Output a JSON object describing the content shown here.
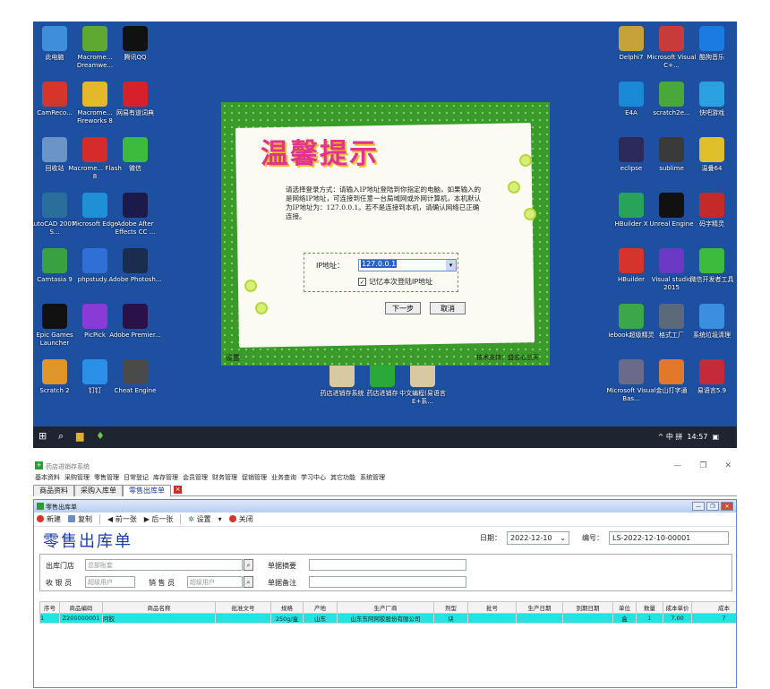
{
  "desktop": {
    "icons_left": [
      {
        "label": "此电脑",
        "icon": "computer-icon",
        "color": "#3d8fd9"
      },
      {
        "label": "Macrome... Dreamwe...",
        "icon": "dreamweaver-icon",
        "color": "#5fa832"
      },
      {
        "label": "腾讯QQ",
        "icon": "qq-icon",
        "color": "#111111"
      },
      {
        "label": "CamReco...",
        "icon": "camtasia-recorder-icon",
        "color": "#d6362a"
      },
      {
        "label": "Macrome... Fireworks 8",
        "icon": "fireworks-icon",
        "color": "#e5b82c"
      },
      {
        "label": "网易有道词典",
        "icon": "youdao-icon",
        "color": "#d6202a"
      },
      {
        "label": "回收站",
        "icon": "recycle-bin-icon",
        "color": "#6a94c4"
      },
      {
        "label": "Macrome... Flash 8",
        "icon": "flash-icon",
        "color": "#d62b2b"
      },
      {
        "label": "微信",
        "icon": "wechat-icon",
        "color": "#3dbb3d"
      },
      {
        "label": "AutoCAD 2007 - S...",
        "icon": "autocad-icon",
        "color": "#2a6f9b"
      },
      {
        "label": "Microsoft Edge",
        "icon": "edge-icon",
        "color": "#1f8fd6"
      },
      {
        "label": "Adobe After Effects CC ...",
        "icon": "after-effects-icon",
        "color": "#1c1a4a"
      },
      {
        "label": "Camtasia 9",
        "icon": "camtasia-icon",
        "color": "#3aa142"
      },
      {
        "label": "phpstudy...",
        "icon": "phpstudy-icon",
        "color": "#2f6fd6"
      },
      {
        "label": "Adobe Photosh...",
        "icon": "photoshop-icon",
        "color": "#1a2d4f"
      },
      {
        "label": "Epic Games Launcher",
        "icon": "epic-games-icon",
        "color": "#111111"
      },
      {
        "label": "PicPick",
        "icon": "picpick-icon",
        "color": "#8a3ad6"
      },
      {
        "label": "Adobe Premier...",
        "icon": "premiere-icon",
        "color": "#2a1147"
      },
      {
        "label": "Scratch 2",
        "icon": "scratch-icon",
        "color": "#e0952a"
      },
      {
        "label": "钉钉",
        "icon": "dingtalk-icon",
        "color": "#2a8fe6"
      },
      {
        "label": "Cheat Engine",
        "icon": "cheat-engine-icon",
        "color": "#4a4a4a"
      }
    ],
    "icons_right": [
      {
        "label": "Delphi7",
        "icon": "delphi-icon",
        "color": "#c7a23a"
      },
      {
        "label": "Microsoft Visual C+...",
        "icon": "visual-cpp-icon",
        "color": "#c93a3a"
      },
      {
        "label": "酷狗音乐",
        "icon": "kugou-icon",
        "color": "#1a7ae0"
      },
      {
        "label": "E4A",
        "icon": "e4a-icon",
        "color": "#1a8ad6"
      },
      {
        "label": "scratch2e...",
        "icon": "flag-icon",
        "color": "#4aa83a"
      },
      {
        "label": "快吧游戏",
        "icon": "kuaiba-icon",
        "color": "#2aa0e0"
      },
      {
        "label": "eclipse",
        "icon": "eclipse-icon",
        "color": "#2c2a5a"
      },
      {
        "label": "sublime",
        "icon": "sublime-icon",
        "color": "#3a3a3a"
      },
      {
        "label": "温叠64",
        "icon": "cube-icon",
        "color": "#e0c02a"
      },
      {
        "label": "HBuilder X",
        "icon": "hbuilderx-icon",
        "color": "#2aa35a"
      },
      {
        "label": "Unreal Engine",
        "icon": "unreal-icon",
        "color": "#111111"
      },
      {
        "label": "码字精灵",
        "icon": "mazi-icon",
        "color": "#c42a2a"
      },
      {
        "label": "HBuilder",
        "icon": "hbuilder-icon",
        "color": "#d6342a"
      },
      {
        "label": "Visual studio 2015",
        "icon": "visual-studio-icon",
        "color": "#6a3ac4"
      },
      {
        "label": "微信开发者工具",
        "icon": "wechat-dev-icon",
        "color": "#3dbb3d"
      },
      {
        "label": "iebook超级精灵",
        "icon": "iebook-icon",
        "color": "#3aa84a"
      },
      {
        "label": "格式工厂",
        "icon": "format-factory-icon",
        "color": "#5a6a7a"
      },
      {
        "label": "系统垃圾清理",
        "icon": "cleaner-icon",
        "color": "#3a8fe0"
      },
      {
        "label": "Microsoft Visual Bas...",
        "icon": "visual-basic-icon",
        "color": "#6a6a8a"
      },
      {
        "label": "金山打字通",
        "icon": "typing-icon",
        "color": "#e07a2a"
      },
      {
        "label": "易语言5.9",
        "icon": "eyuyan-icon",
        "color": "#c42a3a"
      }
    ],
    "icons_center": [
      {
        "label": "药店进销存系统",
        "icon": "book-icon",
        "color": "#d8c9a0"
      },
      {
        "label": "药店进销存",
        "icon": "green-cross-icon",
        "color": "#2aa83a"
      },
      {
        "label": "中文编程(易语言E+系...",
        "icon": "book-icon",
        "color": "#d8c9a0"
      }
    ],
    "dialog": {
      "title": "温馨提示",
      "text": "请选择登录方式：请输入IP地址登陆到你指定的电脑，如果输入的是网络IP地址，可连接到任意一台局域网或外网计算机，本机默认为IP地址为：127.0.0.1。若不是连接到本机，请确认网络已正确连接。",
      "ip_label": "IP地址：",
      "ip_value": "127.0.0.1",
      "remember_label": "记忆本次登陆IP地址",
      "next_button": "下一步",
      "cancel_button": "取消",
      "settings_link": "设置",
      "bottom_right": "技术支持：盛名心兰天"
    },
    "taskbar": {
      "tray": "^  中  拼",
      "time": "14:57"
    }
  },
  "app": {
    "title": "药店进销存系统",
    "menus": [
      "基本资料",
      "采购管理",
      "零售管理",
      "日常登记",
      "库存管理",
      "会员管理",
      "财务管理",
      "促销管理",
      "业务查询",
      "学习中心",
      "其它功能",
      "系统管理"
    ],
    "tabs": [
      "商品资料",
      "采购入库单",
      "零售出库单"
    ],
    "inner_title": "零售出库单",
    "toolbar": {
      "new": "新建",
      "copy": "复制",
      "prev": "前一张",
      "next": "后一张",
      "settings": "设置",
      "close": "关闭"
    },
    "form_title": "零售出库单",
    "date_label": "日期：",
    "date_value": "2022-12-10",
    "no_label": "编号：",
    "no_value": "LS-2022-12-10-00001",
    "fields": {
      "store_label": "出库门店",
      "store_placeholder": "总部账套",
      "summary_label": "单据摘要",
      "cashier_label": "收 银 员",
      "cashier_placeholder": "超级用户",
      "sales_label": "销 售 员",
      "sales_placeholder": "超级用户",
      "remark_label": "单据备注"
    },
    "table": {
      "headers": [
        "序号",
        "商品编码",
        "商品名称",
        "批准文号",
        "规格",
        "产地",
        "生产厂商",
        "剂型",
        "批号",
        "生产日期",
        "到期日期",
        "单位",
        "数量",
        "成本单价",
        "成本"
      ],
      "rows": [
        [
          "1",
          "Z200000001",
          "阿胶",
          "",
          "250g/盒",
          "山东",
          "山东东阿阿胶股份有限公司",
          "块",
          "",
          "",
          "",
          "盒",
          "1",
          "7.00",
          "7"
        ]
      ]
    }
  }
}
